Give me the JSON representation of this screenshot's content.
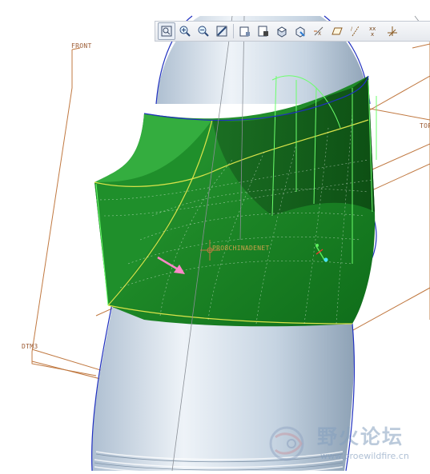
{
  "viewport": {
    "datum_labels": {
      "front": "FRONT",
      "dtm3": "DTM3",
      "top": "TOP",
      "center_label": "PRO8CHINADENET"
    }
  },
  "toolbar": {
    "buttons": [
      {
        "name": "refit-button",
        "icon": "refit-icon"
      },
      {
        "name": "zoom-in-button",
        "icon": "zoom-in-icon"
      },
      {
        "name": "zoom-out-button",
        "icon": "zoom-out-icon"
      },
      {
        "name": "repaint-button",
        "icon": "repaint-icon"
      },
      {
        "name": "reorient-button",
        "icon": "reorient-icon"
      },
      {
        "name": "saved-views-button",
        "icon": "saved-views-icon"
      },
      {
        "name": "display-style-button",
        "icon": "display-style-icon"
      },
      {
        "name": "view-manager-button",
        "icon": "view-manager-icon"
      },
      {
        "name": "spin-center-button",
        "icon": "spin-center-icon"
      },
      {
        "name": "datum-planes-button",
        "icon": "datum-planes-icon"
      },
      {
        "name": "datum-axes-button",
        "icon": "datum-axes-icon"
      },
      {
        "name": "datum-points-button",
        "icon": "datum-points-icon"
      },
      {
        "name": "coordinate-systems-button",
        "icon": "coordinate-systems-icon"
      }
    ]
  },
  "watermark": {
    "title": "野火论坛",
    "url": "www.proewildfire.cn",
    "logo": "proewildfire-logo-icon"
  },
  "colors": {
    "surface_green": "#1e8a28",
    "body_blue": "#b8cde0",
    "datum_orange": "#c07840",
    "edge_blue": "#2030c0"
  }
}
